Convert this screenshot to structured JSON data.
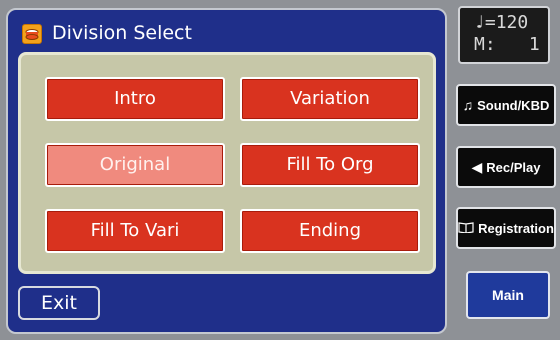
{
  "dialog": {
    "title": "Division Select",
    "title_icon": "drum-icon",
    "divisions": [
      {
        "label": "Intro",
        "active": false
      },
      {
        "label": "Variation",
        "active": false
      },
      {
        "label": "Original",
        "active": true
      },
      {
        "label": "Fill To Org",
        "active": false
      },
      {
        "label": "Fill To Vari",
        "active": false
      },
      {
        "label": "Ending",
        "active": false
      }
    ],
    "exit_label": "Exit"
  },
  "status": {
    "tempo_prefix": "♩=",
    "tempo": "120",
    "measure_prefix": "M:",
    "measure": "1"
  },
  "side_menu": {
    "sound_kbd": {
      "icon": "music-note-icon",
      "glyph": "♫",
      "label": "Sound/KBD"
    },
    "rec_play": {
      "icon": "speaker-icon",
      "glyph": "◀",
      "label": "Rec/Play"
    },
    "registration": {
      "icon": "book-icon",
      "glyph": "📖",
      "label": "Registration"
    },
    "main": "Main"
  },
  "colors": {
    "panel_blue": "#1f2f8a",
    "button_red": "#d9331f",
    "button_selected": "#f08a7e",
    "side_gray": "#8e9196"
  }
}
